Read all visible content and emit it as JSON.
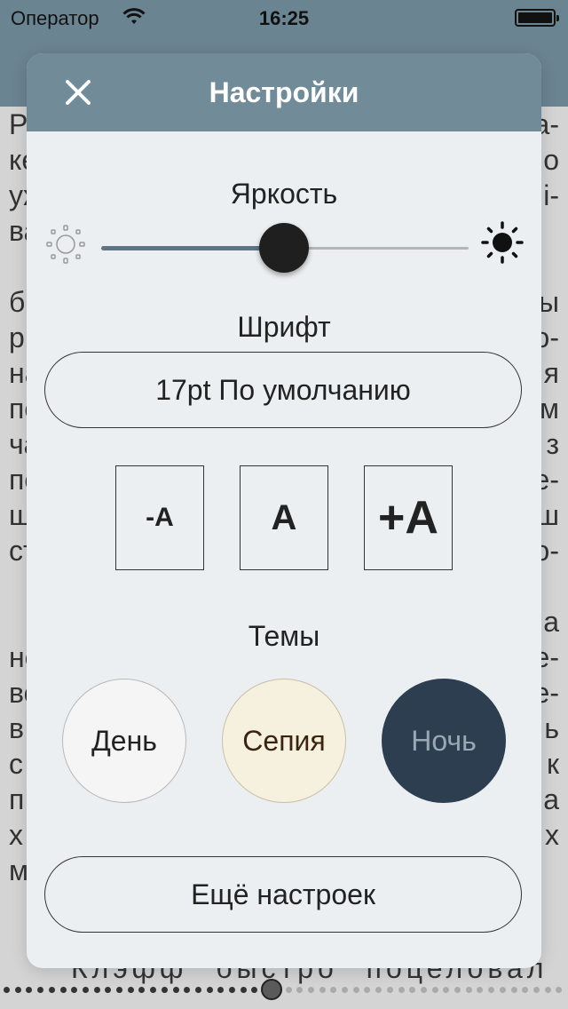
{
  "status_bar": {
    "carrier": "Оператор",
    "time": "16:25"
  },
  "background_text": {
    "left_fragments": [
      "Р",
      "ке",
      "уж",
      "ва",
      "",
      "б",
      "р",
      "на",
      "по",
      "ча",
      "по",
      "щ",
      "ст",
      "",
      "",
      "не",
      "вс",
      "в",
      "с",
      "п",
      "х",
      "м"
    ],
    "right_fragments": [
      "а-",
      "о",
      "і-",
      "",
      "",
      "ы",
      "о-",
      "я",
      "м",
      "з",
      "е-",
      "ш",
      "о-",
      "",
      "а",
      "е-",
      "е-",
      "ь",
      "к",
      "а",
      "х",
      ""
    ],
    "bottom_line": "Клэфф быстро поцеловал ее и"
  },
  "modal": {
    "title": "Настройки",
    "brightness": {
      "label": "Яркость",
      "value": 0.5
    },
    "font": {
      "label": "Шрифт",
      "current": "17pt По умолчанию"
    },
    "size_buttons": {
      "decrease": "-A",
      "reset": "A",
      "increase": "+A"
    },
    "themes": {
      "label": "Темы",
      "day": "День",
      "sepia": "Сепия",
      "night": "Ночь"
    },
    "more_settings": "Ещё настроек"
  },
  "colors": {
    "nav": "#718b98",
    "modal_bg": "#eceff1",
    "day_bg": "#f5f5f5",
    "sepia_bg": "#f6f0de",
    "night_bg": "#2c3e50",
    "night_text": "#9aa8b5",
    "sepia_text": "#3a2410"
  },
  "pager": {
    "position": 0.47
  }
}
